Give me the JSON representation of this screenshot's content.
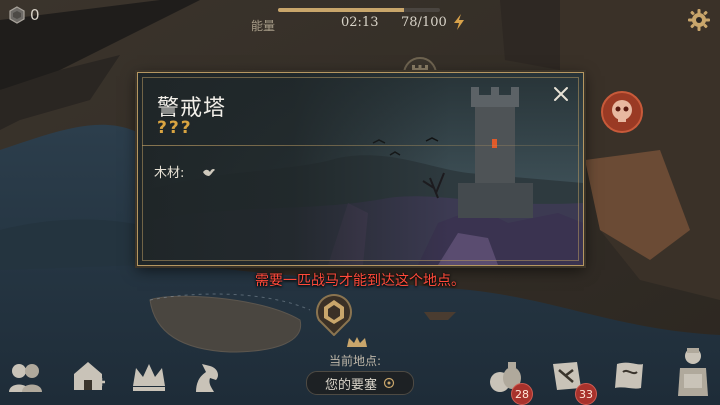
{
  "hud": {
    "coins": "0",
    "energy_label": "能量",
    "timer": "02:13",
    "energy_count": "78/100",
    "energy_fraction": 0.78
  },
  "popup": {
    "title": "警戒塔",
    "subtitle": "???",
    "resource_label": "木材:"
  },
  "warning": "需要一匹战马才能到达这个地点。",
  "location": {
    "label": "当前地点:",
    "name": "您的要塞"
  },
  "badges": {
    "resources": "28",
    "map": "33"
  },
  "colors": {
    "accent_gold": "#b59761",
    "question_gold": "#d9a441",
    "warning_red": "#ff4a3a",
    "badge_red": "#a8322c"
  }
}
